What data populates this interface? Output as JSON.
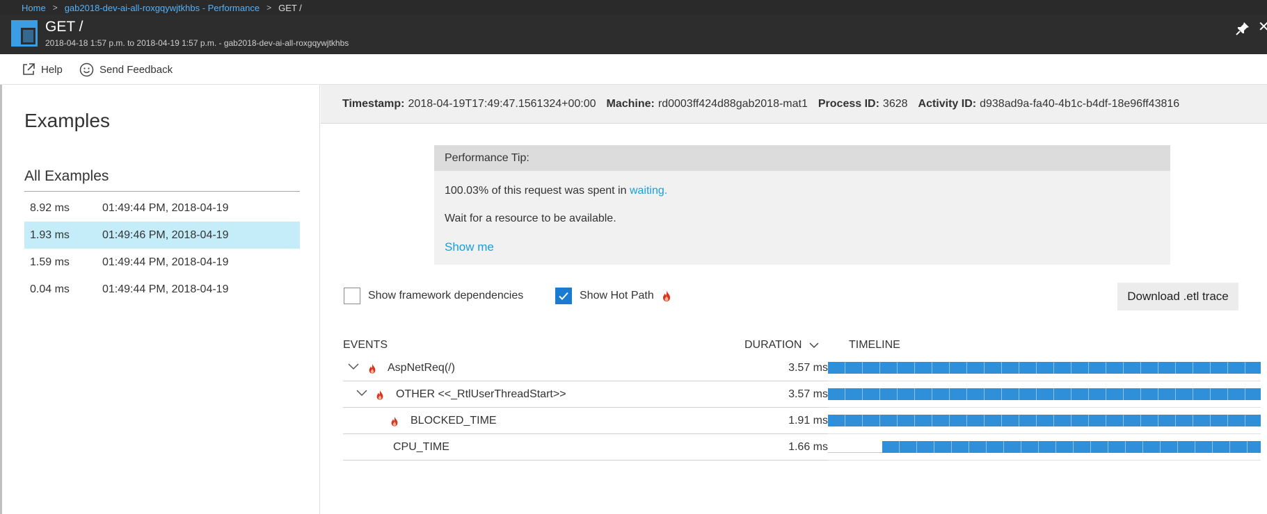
{
  "breadcrumb": {
    "home": "Home",
    "resource": "gab2018-dev-ai-all-roxgqywjtkhbs - Performance",
    "current": "GET /",
    "separator": ">"
  },
  "title_bar": {
    "title": "GET /",
    "subtitle": "2018-04-18 1:57 p.m. to 2018-04-19 1:57 p.m. - gab2018-dev-ai-all-roxgqywjtkhbs",
    "close_glyph": "✕"
  },
  "toolbar": {
    "help": "Help",
    "feedback": "Send Feedback"
  },
  "examples": {
    "title": "Examples",
    "subtitle": "All Examples",
    "rows": [
      {
        "duration": "8.92 ms",
        "time": "01:49:44 PM, 2018-04-19",
        "selected": false
      },
      {
        "duration": "1.93 ms",
        "time": "01:49:46 PM, 2018-04-19",
        "selected": true
      },
      {
        "duration": "1.59 ms",
        "time": "01:49:44 PM, 2018-04-19",
        "selected": false
      },
      {
        "duration": "0.04 ms",
        "time": "01:49:44 PM, 2018-04-19",
        "selected": false
      }
    ]
  },
  "details": {
    "timestamp_label": "Timestamp:",
    "timestamp": "2018-04-19T17:49:47.1561324+00:00",
    "machine_label": "Machine:",
    "machine": "rd0003ff424d88gab2018-mat1",
    "pid_label": "Process ID:",
    "pid": "3628",
    "activity_label": "Activity ID:",
    "activity": "d938ad9a-fa40-4b1c-b4df-18e96ff43816"
  },
  "tip": {
    "header": "Performance Tip:",
    "line1_prefix": "100.03% of this request was spent in ",
    "line1_link": "waiting.",
    "line2": "Wait for a resource to be available.",
    "show_me": "Show me"
  },
  "options": {
    "framework_label": "Show framework dependencies",
    "framework_checked": false,
    "hotpath_label": "Show Hot Path",
    "hotpath_checked": true,
    "download": "Download .etl trace"
  },
  "table": {
    "events_header": "EVENTS",
    "duration_header": "DURATION",
    "timeline_header": "TIMELINE",
    "rows": [
      {
        "name": "AspNetReq(/)",
        "duration": "3.57 ms",
        "hot": true,
        "expander": true,
        "level": 0,
        "tl_start": 0.0,
        "tl_fraction": 1.0
      },
      {
        "name": "OTHER <<_RtlUserThreadStart>>",
        "duration": "3.57 ms",
        "hot": true,
        "expander": true,
        "level": 1,
        "tl_start": 0.0,
        "tl_fraction": 1.0
      },
      {
        "name": "BLOCKED_TIME",
        "duration": "1.91 ms",
        "hot": true,
        "expander": false,
        "level": 2,
        "tl_start": 0.0,
        "tl_fraction": 1.0
      },
      {
        "name": "CPU_TIME",
        "duration": "1.66 ms",
        "hot": false,
        "expander": false,
        "level": 2,
        "tl_start": 0.125,
        "tl_fraction": 0.875
      }
    ]
  },
  "colors": {
    "accent": "#1a9ddb",
    "selected_row": "#c5ecf9",
    "timeline_bar": "#2f8fd8",
    "flame": "#d9321e"
  }
}
